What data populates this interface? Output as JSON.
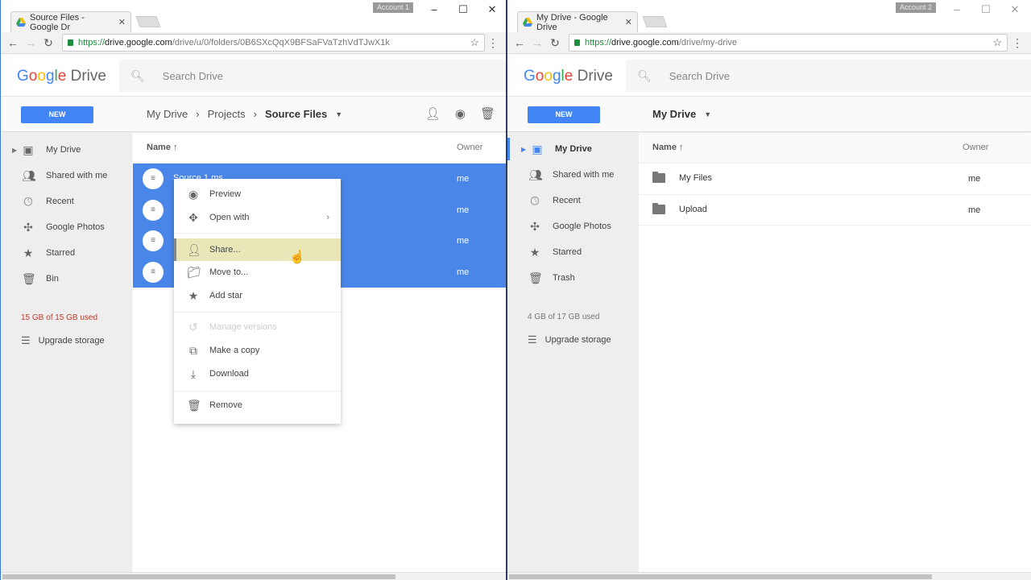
{
  "left": {
    "tab_title": "Source Files - Google Dr",
    "account_badge": "Account 1",
    "window_controls": [
      "–",
      "☐",
      "✕"
    ],
    "url_scheme": "https://",
    "url_host": "drive.google.com",
    "url_path": "/drive/u/0/folders/0B6SXcQqX9BFSaFVaTzhVdTJwX1k",
    "logo": {
      "g1": "G",
      "g2": "o",
      "g3": "o",
      "g4": "g",
      "g5": "l",
      "g6": "e",
      "rest": " Drive"
    },
    "search_placeholder": "Search Drive",
    "new_label": "NEW",
    "breadcrumb": [
      "My Drive",
      "Projects",
      "Source Files"
    ],
    "sidebar": [
      {
        "label": "My Drive",
        "icon": "drive-icon"
      },
      {
        "label": "Shared with me",
        "icon": "people-icon"
      },
      {
        "label": "Recent",
        "icon": "clock-icon"
      },
      {
        "label": "Google Photos",
        "icon": "photos-icon"
      },
      {
        "label": "Starred",
        "icon": "star-icon"
      },
      {
        "label": "Bin",
        "icon": "trash-icon"
      }
    ],
    "quota": "15 GB of 15 GB used",
    "quota_color": "#c0392b",
    "upgrade": "Upgrade storage",
    "columns": {
      "name": "Name",
      "owner": "Owner"
    },
    "files": [
      {
        "name": "Source 1.ms",
        "owner": "me"
      },
      {
        "name": "",
        "owner": "me"
      },
      {
        "name": "",
        "owner": "me"
      },
      {
        "name": "",
        "owner": "me"
      }
    ],
    "context_menu": [
      {
        "label": "Preview",
        "icon": "eye-icon"
      },
      {
        "label": "Open with",
        "icon": "open-with-icon",
        "submenu": "›"
      },
      {
        "label": "Share...",
        "icon": "add-person-icon",
        "highlighted": true
      },
      {
        "label": "Move to...",
        "icon": "move-folder-icon"
      },
      {
        "label": "Add star",
        "icon": "star-icon"
      },
      {
        "label": "Manage versions",
        "icon": "history-icon",
        "disabled": true
      },
      {
        "label": "Make a copy",
        "icon": "copy-icon"
      },
      {
        "label": "Download",
        "icon": "download-icon"
      },
      {
        "label": "Remove",
        "icon": "trash-icon"
      }
    ]
  },
  "right": {
    "tab_title": "My Drive - Google Drive",
    "account_badge": "Account 2",
    "window_controls": [
      "–",
      "☐",
      "✕"
    ],
    "url_scheme": "https://",
    "url_host": "drive.google.com",
    "url_path": "/drive/my-drive",
    "search_placeholder": "Search Drive",
    "new_label": "NEW",
    "location": "My Drive",
    "sidebar": [
      {
        "label": "My Drive",
        "icon": "drive-icon"
      },
      {
        "label": "Shared with me",
        "icon": "people-icon"
      },
      {
        "label": "Recent",
        "icon": "clock-icon"
      },
      {
        "label": "Google Photos",
        "icon": "photos-icon"
      },
      {
        "label": "Starred",
        "icon": "star-icon"
      },
      {
        "label": "Trash",
        "icon": "trash-icon"
      }
    ],
    "quota": "4 GB of 17 GB used",
    "upgrade": "Upgrade storage",
    "columns": {
      "name": "Name",
      "owner": "Owner"
    },
    "files": [
      {
        "name": "My Files",
        "owner": "me"
      },
      {
        "name": "Upload",
        "owner": "me"
      }
    ]
  },
  "colors": {
    "accent": "#4285f4",
    "selection": "#4a86e8",
    "highlight": "#e9e7b8"
  }
}
